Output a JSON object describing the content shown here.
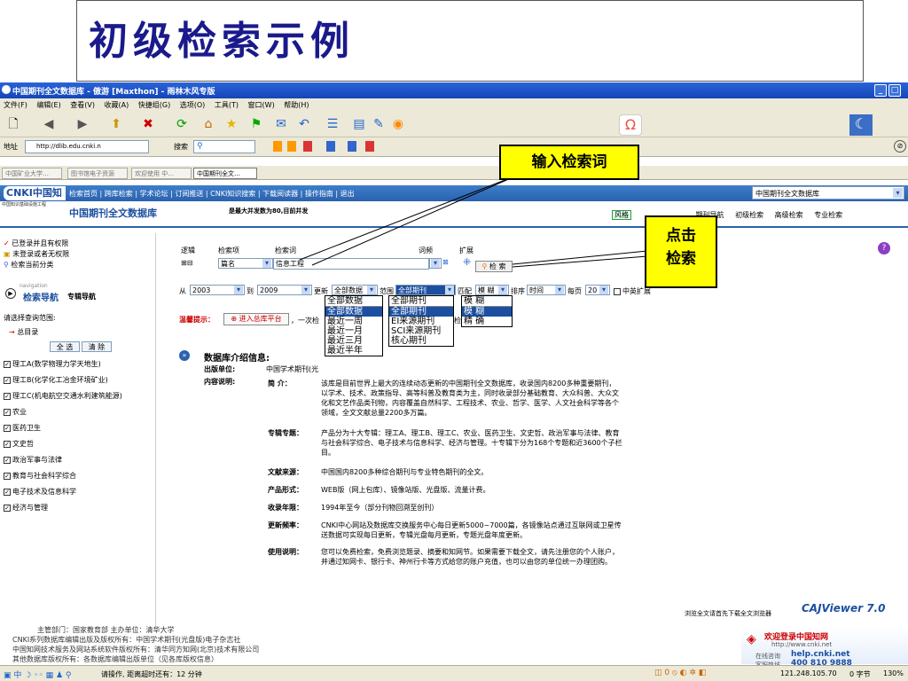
{
  "slide": {
    "title": "初级检索示例"
  },
  "window": {
    "title": "中国期刊全文数据库 - 傲游 [Maxthon] - 雨林木风专版",
    "menu": [
      "文件(F)",
      "编辑(E)",
      "查看(V)",
      "收藏(A)",
      "快捷组(G)",
      "选项(O)",
      "工具(T)",
      "窗口(W)",
      "帮助(H)"
    ],
    "address_label": "地址",
    "address_value": "http://dlib.edu.cnki.n",
    "search_label": "搜索"
  },
  "tabs": [
    "中国矿业大学…",
    "图书馆电子资源",
    "欢迎使用 中…",
    "中国期刊全文…"
  ],
  "cnki": {
    "logo": "CNKI中国知网",
    "logo_sub": "中国知识基础设施工程",
    "nav_links": "检索首页 | 跨库检索 | 学术论坛 | 订阅推送 | CNKI知识搜索 | 下载阅读器 | 操作指南 | 退出",
    "db_select": "中国期刊全文数据库",
    "db_title": "中国期刊全文数据库",
    "subtitle": "是最大并发数为80,目前并发",
    "nav_tabs": [
      "风格",
      "期刊导航",
      "初级检索",
      "高级检索",
      "专业检索"
    ]
  },
  "sidebar": {
    "status": [
      "已登录并且有权限",
      "未登录或者无权限",
      "检索当前分类"
    ],
    "nav_small": "navigation",
    "nav_title": "检索导航",
    "nav_tab2": "专辑导航",
    "select_range": "请选择查询范围:",
    "root": "总目录",
    "btn_all": "全 选",
    "btn_clear": "清 除",
    "categories": [
      "理工A(数学物理力学天地生)",
      "理工B(化学化工冶金环境矿业)",
      "理工C(机电航空交通水利建筑能源)",
      "农业",
      "医药卫生",
      "文史哲",
      "政治军事与法律",
      "教育与社会科学综合",
      "电子技术及信息科学",
      "经济与管理"
    ]
  },
  "search": {
    "headers": [
      "逻辑",
      "检索项",
      "检索词",
      "词频",
      "扩展"
    ],
    "field_value": "篇名",
    "term_value": "信息工程",
    "search_btn": "检 索",
    "from_label": "从",
    "from_year": "2003",
    "to_label": "到",
    "to_year": "2009",
    "update_label": "更新",
    "update_value": "全部数据",
    "range_label": "范围",
    "range_value": "全部期刊",
    "match_label": "匹配",
    "match_value": "模 糊",
    "sort_label": "排序",
    "sort_value": "时间",
    "perpage_label": "每页",
    "perpage_value": "20",
    "zhongying": "中英扩展",
    "dd_update_head": "全部数据",
    "dd_update": [
      "全部数据",
      "最近一周",
      "最近一月",
      "最近三月",
      "最近半年"
    ],
    "dd_range_head": "全部期刊",
    "dd_range": [
      "全部期刊",
      "EI来源期刊",
      "SCI来源期刊",
      "核心期刊"
    ],
    "dd_match_head": "模 糊",
    "dd_match": [
      "模 糊",
      "精 确"
    ],
    "tip_label": "温馨提示：",
    "tip_btn": "进入总库平台",
    "tip_text": "，一次检",
    "tip_text2": "检"
  },
  "info": {
    "heading": "数据库介绍信息:",
    "publisher_label": "出版单位:",
    "publisher_value": "中国学术期刊(光",
    "content_label": "内容说明:",
    "brief_label": "简 介：",
    "brief_text": "该库是目前世界上最大的连续动态更新的中国期刊全文数据库，收录国内8200多种重要期刊，以学术、技术、政策指导、高等科普及教育类为主，同时收录部分基础教育、大众科普、大众文化和文艺作品类刊物，内容覆盖自然科学、工程技术、农业、哲学、医学、人文社会科学等各个领域，全文文献总量2200多万篇。",
    "special_label": "专辑专题：",
    "special_text": "产品分为十大专辑：理工A、理工B、理工C、农业、医药卫生、文史哲、政治军事与法律、教育与社会科学综合、电子技术与信息科学、经济与管理。十专辑下分为168个专题和近3600个子栏目。",
    "source_label": "文献来源：",
    "source_text": "中国国内8200多种综合期刊与专业特色期刊的全文。",
    "form_label": "产品形式：",
    "form_text": "WEB版（网上包库）、镜像站版、光盘版、流量计费。",
    "years_label": "收录年限：",
    "years_text": "1994年至今（部分刊物回溯至创刊）",
    "freq_label": "更新频率：",
    "freq_text": "CNKI中心网站及数据库交换服务中心每日更新5000~7000篇，各镜像站点通过互联网或卫星传送数据可实现每日更新，专辑光盘每月更新，专题光盘年度更新。",
    "usage_label": "使用说明：",
    "usage_text": "您可以免费检索，免费浏览题录、摘要和知网节。如果需要下载全文，请先注册您的个人账户，并通过知网卡、银行卡、神州行卡等方式给您的账户充值，也可以由您的单位统一办理团购。"
  },
  "cajviewer": {
    "note": "浏览全文请首先下载全文浏览器",
    "logo": "CAJViewer 7.0"
  },
  "welcome": {
    "line1": "欢迎登录中国知网",
    "line2": "http://www.cnki.net",
    "line3": "在线咨询",
    "line4": "help.cnki.net",
    "line5": "客服热线",
    "line6": "400 810 9888"
  },
  "footer": [
    "主管部门：国家教育部    主办单位：清华大学",
    "CNKI系列数据库编辑出版及版权所有：中国学术期刊(光盘版)电子杂志社",
    "中国知网技术服务及网站系统软件版权所有：清华同方知网(北京)技术有限公司",
    "其他数据库版权所有：各数据库编辑出版单位（见各库版权信息）"
  ],
  "status": {
    "text": "请操作, 距离超时还有：12 分钟",
    "ip": "121.248.105.70",
    "bytes": "0 字节",
    "zoom": "130%"
  },
  "callouts": {
    "enter_term": "输入检索词",
    "click_search": "点击\n检索"
  }
}
